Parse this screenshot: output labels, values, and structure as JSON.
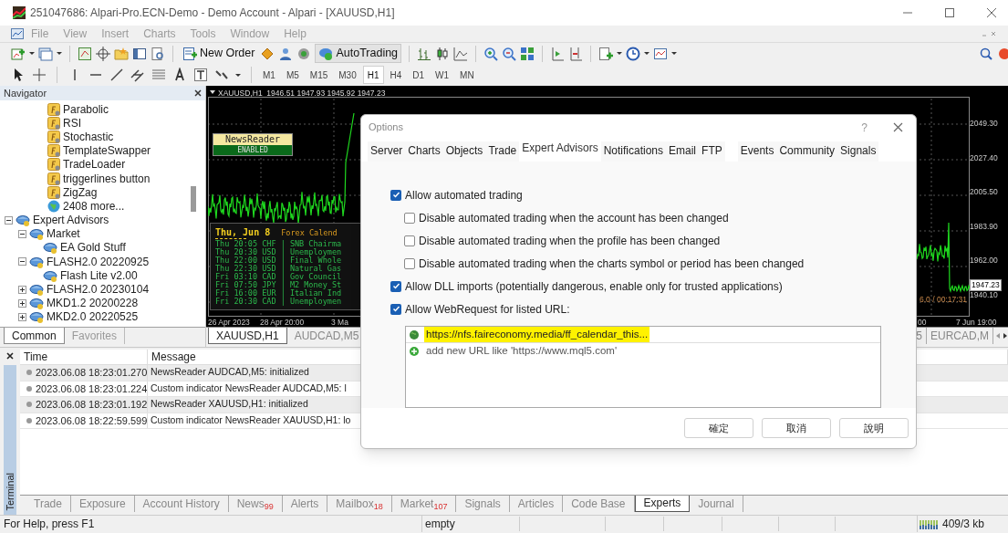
{
  "window": {
    "title": "251047686: Alpari-Pro.ECN-Demo - Demo Account - Alpari - [XAUUSD,H1]"
  },
  "menu": [
    "File",
    "View",
    "Insert",
    "Charts",
    "Tools",
    "Window",
    "Help"
  ],
  "toolbar": {
    "new_order": "New Order",
    "autotrading": "AutoTrading"
  },
  "timeframes": [
    {
      "label": "M1",
      "selected": false
    },
    {
      "label": "M5",
      "selected": false
    },
    {
      "label": "M15",
      "selected": false
    },
    {
      "label": "M30",
      "selected": false
    },
    {
      "label": "H1",
      "selected": true
    },
    {
      "label": "H4",
      "selected": false
    },
    {
      "label": "D1",
      "selected": false
    },
    {
      "label": "W1",
      "selected": false
    },
    {
      "label": "MN",
      "selected": false
    }
  ],
  "navigator": {
    "title": "Navigator",
    "indicator_items": [
      {
        "label": "Parabolic",
        "kind": "indicator"
      },
      {
        "label": "RSI",
        "kind": "indicator"
      },
      {
        "label": "Stochastic",
        "kind": "indicator"
      },
      {
        "label": "TemplateSwapper",
        "kind": "indicator"
      },
      {
        "label": "TradeLoader",
        "kind": "indicator"
      },
      {
        "label": "triggerlines button",
        "kind": "indicator"
      },
      {
        "label": "ZigZag",
        "kind": "indicator"
      },
      {
        "label": "2408 more...",
        "kind": "more"
      }
    ],
    "tree": [
      {
        "label": "Expert Advisors",
        "expanded": true,
        "children": [
          {
            "label": "Market",
            "expanded": true,
            "children": [
              {
                "label": "EA Gold Stuff"
              }
            ]
          },
          {
            "label": "FLASH2.0 20220925",
            "expanded": true,
            "children": [
              {
                "label": "Flash Lite v2.00"
              }
            ]
          },
          {
            "label": "FLASH2.0 20230104",
            "expanded": false
          },
          {
            "label": "MKD1.2 20200228",
            "expanded": false
          },
          {
            "label": "MKD2.0 20220525",
            "expanded": false
          }
        ]
      }
    ],
    "tabs": [
      {
        "label": "Common",
        "selected": true
      },
      {
        "label": "Favorites",
        "selected": false
      }
    ]
  },
  "chart": {
    "header": "XAUUSD,H1  1946.51 1947.93 1945.92 1947.23",
    "indicator_badge": {
      "name": "NewsReader",
      "status": "ENABLED"
    },
    "calendar": {
      "date": "Thu, Jun 8",
      "title": "Forex Calend",
      "rows": [
        "Thu 20:05 CHF | SNB Chairma",
        "Thu 20:30 USD | Unemploymen",
        "Thu 22:00 USD | Final Whole",
        "Thu 22:30 USD | Natural Gas",
        "Fri 03:10 CAD | Gov Council",
        "Fri 07:50 JPY | M2 Money St",
        "Fri 16:00 EUR | Italian Ind",
        "Fri 20:30 CAD | Unemploymen"
      ]
    },
    "price_labels": [
      {
        "text": "2049.30",
        "kind": "tick"
      },
      {
        "text": "2027.40",
        "kind": "tick"
      },
      {
        "text": "2005.50",
        "kind": "tick"
      },
      {
        "text": "1983.90",
        "kind": "tick"
      },
      {
        "text": "1962.00",
        "kind": "tick"
      },
      {
        "text": "1947.23",
        "kind": "current"
      },
      {
        "text": "1940.10",
        "kind": "tick"
      }
    ],
    "time_labels": [
      "26 Apr 2023",
      "28 Apr 20:00",
      "3 Ma",
      "00",
      "7 Jun 19:00"
    ],
    "countdown": "6.0 / 00:17:31"
  },
  "chart_tabs": [
    {
      "label": "XAUUSD,H1",
      "selected": true
    },
    {
      "label": "AUDCAD,M5",
      "selected": false
    },
    {
      "label": "5",
      "selected": false
    },
    {
      "label": "EURCAD,M",
      "selected": false
    }
  ],
  "terminal": {
    "title": "Terminal",
    "columns": [
      "Time",
      "Message"
    ],
    "rows": [
      {
        "time": "2023.06.08 18:23:01.270",
        "message": "NewsReader AUDCAD,M5: initialized"
      },
      {
        "time": "2023.06.08 18:23:01.224",
        "message": "Custom indicator NewsReader AUDCAD,M5: l"
      },
      {
        "time": "2023.06.08 18:23:01.192",
        "message": "NewsReader XAUUSD,H1: initialized"
      },
      {
        "time": "2023.06.08 18:22:59.599",
        "message": "Custom indicator NewsReader XAUUSD,H1: lo"
      }
    ],
    "tabs": [
      {
        "label": "Trade",
        "selected": false
      },
      {
        "label": "Exposure",
        "selected": false
      },
      {
        "label": "Account History",
        "selected": false
      },
      {
        "label": "News",
        "count": "99",
        "selected": false
      },
      {
        "label": "Alerts",
        "selected": false
      },
      {
        "label": "Mailbox",
        "count": "18",
        "selected": false
      },
      {
        "label": "Market",
        "count": "107",
        "selected": false
      },
      {
        "label": "Signals",
        "selected": false
      },
      {
        "label": "Articles",
        "selected": false
      },
      {
        "label": "Code Base",
        "selected": false
      },
      {
        "label": "Experts",
        "selected": true
      },
      {
        "label": "Journal",
        "selected": false
      }
    ]
  },
  "status_bar": {
    "help": "For Help, press F1",
    "profile": "empty",
    "traffic": "409/3 kb"
  },
  "dialog": {
    "title": "Options",
    "help": "?",
    "tabs": [
      {
        "label": "Server",
        "selected": false
      },
      {
        "label": "Charts",
        "selected": false
      },
      {
        "label": "Objects",
        "selected": false
      },
      {
        "label": "Trade",
        "selected": false
      },
      {
        "label": "Expert Advisors",
        "selected": true
      },
      {
        "label": "Notifications",
        "selected": false
      },
      {
        "label": "Email",
        "selected": false
      },
      {
        "label": "FTP",
        "selected": false
      },
      {
        "label": "Events",
        "selected": false
      },
      {
        "label": "Community",
        "selected": false
      },
      {
        "label": "Signals",
        "selected": false
      }
    ],
    "options": [
      {
        "label": "Allow automated trading",
        "checked": true,
        "children": [
          {
            "label": "Disable automated trading when the account has been changed",
            "checked": false
          },
          {
            "label": "Disable automated trading when the profile has been changed",
            "checked": false
          },
          {
            "label": "Disable automated trading when the charts symbol or period has been changed",
            "checked": false
          }
        ]
      },
      {
        "label": "Allow DLL imports (potentially dangerous, enable only for trusted applications)",
        "checked": true
      },
      {
        "label": "Allow WebRequest for listed URL:",
        "checked": true
      }
    ],
    "urls": [
      {
        "text": "https://nfs.faireconomy.media/ff_calendar_this...",
        "kind": "url",
        "highlighted": true
      },
      {
        "text": "add new URL like 'https://www.mql5.com'",
        "kind": "add",
        "highlighted": false
      }
    ],
    "buttons": [
      "確定",
      "取消",
      "說明"
    ]
  }
}
